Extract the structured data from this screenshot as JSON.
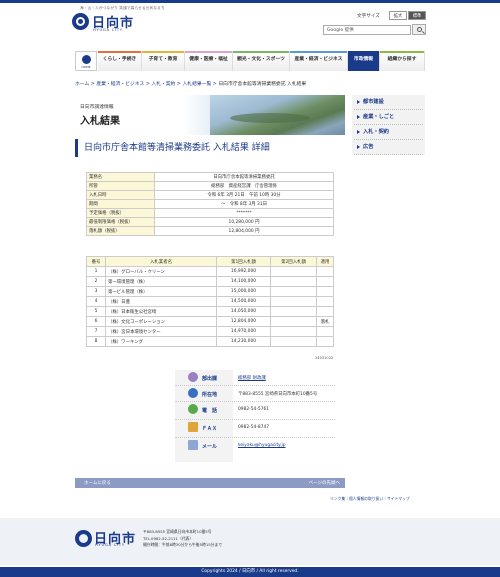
{
  "header": {
    "tagline": "海・山・人がつながり 笑顔で暮らせる元気なまち",
    "logo_text": "日向市",
    "logo_sub": "HYUGA CITY",
    "text_size_label": "文字サイズ",
    "text_size_large": "拡大",
    "text_size_standard": "標準",
    "search_placeholder": "Google 提供"
  },
  "nav": {
    "home_label": "HOME",
    "items": [
      {
        "label": "くらし・手続き",
        "color": "#e2703a"
      },
      {
        "label": "子育て・教育",
        "color": "#e9b23a"
      },
      {
        "label": "健康・医療・福祉",
        "color": "#d9a6c9"
      },
      {
        "label": "観光・文化・スポーツ",
        "color": "#7db66a"
      },
      {
        "label": "産業・経済・ビジネス",
        "color": "#5b9bd5"
      },
      {
        "label": "市政情報",
        "color": "#1a3a8a"
      },
      {
        "label": "組織から探す",
        "color": "#8db84a"
      }
    ]
  },
  "breadcrumb": {
    "home": "ホーム",
    "l1": "産業・経済・ビジネス",
    "l2": "入札・契約",
    "l3": "入札結果一覧",
    "current": "日向市庁舎本館等清掃業務委託 入札結果"
  },
  "hero": {
    "subtitle": "日向市調達情報",
    "title": "入札結果"
  },
  "sidebar": {
    "items": [
      {
        "label": "都市建設"
      },
      {
        "label": "産業・しごと"
      },
      {
        "label": "入札・契約"
      },
      {
        "label": "広告"
      }
    ]
  },
  "page_title": "日向市庁舎本館等清掃業務委託 入札結果 詳細",
  "summary": {
    "rows": [
      {
        "k": "業務名",
        "v": "日向市庁舎本館等清掃業務委託"
      },
      {
        "k": "所管",
        "v": "総務部　資産経営課　庁舎管理係"
      },
      {
        "k": "入札日時",
        "v": "令和 6年 3月 21日　午前 10時 30分"
      },
      {
        "k": "期間",
        "v": "～　令和 8年 3月 31日"
      },
      {
        "k": "予定価格（税抜）",
        "v": "*******"
      },
      {
        "k": "最低制限価格（税抜）",
        "v": "10,280,000 円"
      },
      {
        "k": "落札額（税抜）",
        "v": "12,804,000 円"
      }
    ]
  },
  "bids": {
    "headers": {
      "num": "番号",
      "name": "入札業者名",
      "round1": "第1回入札額",
      "round2": "第2回入札額",
      "remark": "適用"
    },
    "rows": [
      {
        "num": "1",
        "name": "（株）グローバル・クリーン",
        "round1": "16,992,000",
        "round2": "",
        "remark": ""
      },
      {
        "num": "2",
        "name": "第一環境管理（株）",
        "round1": "14,100,000",
        "round2": "",
        "remark": ""
      },
      {
        "num": "3",
        "name": "第一ビル管理（株）",
        "round1": "15,000,000",
        "round2": "",
        "remark": ""
      },
      {
        "num": "4",
        "name": "（株）日豊",
        "round1": "14,500,000",
        "round2": "",
        "remark": ""
      },
      {
        "num": "5",
        "name": "（株）日本衛生公社宮崎",
        "round1": "14,050,000",
        "round2": "",
        "remark": ""
      },
      {
        "num": "6",
        "name": "（株）文化コーポレーション",
        "round1": "12,804,000",
        "round2": "",
        "remark": "落札"
      },
      {
        "num": "7",
        "name": "（株）宮日本環境センター",
        "round1": "14,970,000",
        "round2": "",
        "remark": ""
      },
      {
        "num": "8",
        "name": "（株）ワーキング",
        "round1": "14,230,000",
        "round2": "",
        "remark": ""
      }
    ],
    "note": "24031022"
  },
  "contact": {
    "dept_label": "部出課",
    "dept_value": "総務部 財政課",
    "addr_label": "所在地",
    "addr_value": "〒883-8555 宮崎県日向市本町10番5号",
    "tel_label": "電　話",
    "tel_value": "0982-54-5761",
    "fax_label": "ＦＡＸ",
    "fax_value": "0982-54-8747",
    "mail_label": "メール",
    "mail_value": "keiyaku@hyugacity.jp"
  },
  "bottom_bar": {
    "home": "ホームに戻る",
    "top": "ページの先頭へ"
  },
  "foot_links": "リンク集｜個人情報の取り扱い｜サイトマップ",
  "footer": {
    "logo_text": "日向市",
    "logo_sub": "HYUGA CITY",
    "addr1": "〒883-8555 宮崎県日向市本町10番5号",
    "addr2": "TEL.0982-52-2111（代表）",
    "addr3": "開庁時間：午前8時30分から午後5時15分まで",
    "copyright": "Copyrights 2024 / 日向市 / All right reserved."
  }
}
